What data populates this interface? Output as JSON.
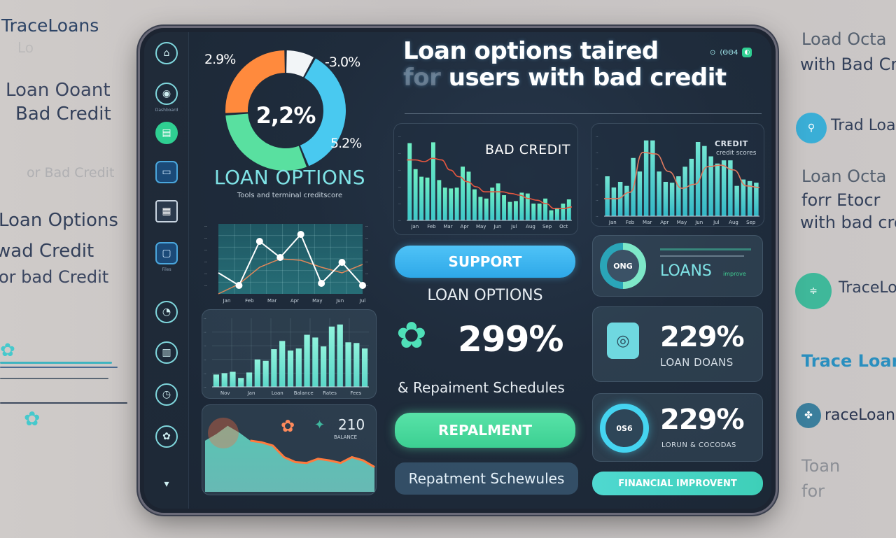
{
  "background": {
    "left": {
      "brand": "TraceLoans",
      "brand_faint": "Lo",
      "heading_line1": "Loan Ooant",
      "heading_line2": "Bad Credit",
      "faint_line": "or Bad Credit",
      "list_line1": "Loan Options",
      "list_line2": "wad Credit",
      "list_line3": "or bad Credit"
    },
    "right": {
      "line1": "Load Octa",
      "line2": "with Bad Credit",
      "item1_label": "Trad Loans",
      "line3": "Loan Octa",
      "line4": "forr Etocr",
      "line5": "with bad credit",
      "item2_label": "TraceLoans",
      "brand_link": "Trace Loans",
      "item3_label": "raceLoans",
      "line6": "Toan",
      "line7": "for"
    }
  },
  "app": {
    "title_line1": "Loan options taired",
    "title_prefix_ghost": "for",
    "title_line2": "users with bad credit",
    "status_icons": [
      "lock-icon",
      "battery-icon",
      "app-badge-icon"
    ],
    "status_text": "(ΘΘ4"
  },
  "sidebar": {
    "items": [
      {
        "icon": "home-icon",
        "glyph": "⌂"
      },
      {
        "icon": "eye-icon",
        "glyph": "◉",
        "label": "Dashboard"
      },
      {
        "icon": "document-icon",
        "glyph": "▤",
        "active": true
      },
      {
        "icon": "wallet-icon",
        "glyph": "▭"
      },
      {
        "icon": "calendar-icon",
        "glyph": "▦"
      },
      {
        "icon": "folder-icon",
        "glyph": "▢",
        "label": "Files"
      },
      {
        "icon": "gauge-icon",
        "glyph": "◔"
      },
      {
        "icon": "chart-icon",
        "glyph": "▥"
      },
      {
        "icon": "clock-icon",
        "glyph": "◷"
      },
      {
        "icon": "settings-icon",
        "glyph": "✿"
      },
      {
        "icon": "collapse-icon",
        "glyph": "▾"
      }
    ]
  },
  "donut": {
    "center_value": "2,2%",
    "label_top_left": "2.9%",
    "label_top_right": "-3.0%",
    "label_bottom_right": "5.2%",
    "title": "LOAN OPTIONS",
    "subtitle": "Tools and terminal creditscore",
    "colors": {
      "orange": "#ff8a3d",
      "white": "#f2f5f7",
      "cyan": "#49c9f0",
      "green": "#59e0a0"
    },
    "segments": [
      {
        "name": "white",
        "fraction": 0.08
      },
      {
        "name": "cyan",
        "fraction": 0.36
      },
      {
        "name": "green",
        "fraction": 0.3
      },
      {
        "name": "orange",
        "fraction": 0.26
      }
    ]
  },
  "chart_data": [
    {
      "id": "bad-credit-chart",
      "type": "bar",
      "title": "BAD CREDIT",
      "x_tick_labels": [
        "Jan",
        "Feb",
        "Mar",
        "Apr",
        "May",
        "Jun",
        "Jul",
        "Aug",
        "Sep",
        "Oct"
      ],
      "values": [
        92,
        61,
        52,
        51,
        93,
        48,
        39,
        38,
        39,
        64,
        58,
        37,
        28,
        26,
        39,
        44,
        30,
        22,
        23,
        33,
        32,
        20,
        20,
        26,
        12,
        15,
        20,
        25
      ],
      "trend": [
        72,
        72,
        70,
        74,
        72,
        60,
        52,
        46,
        40,
        34,
        34,
        34,
        32,
        30,
        26,
        24,
        20,
        14,
        14,
        16
      ],
      "ylim": [
        0,
        100
      ]
    },
    {
      "id": "credit-chart",
      "type": "bar",
      "title": "CREDIT",
      "subtitle": "credit scores",
      "x_tick_labels": [
        "Jan",
        "Feb",
        "Mar",
        "Apr",
        "May",
        "Jun",
        "Jul",
        "Aug",
        "Sep"
      ],
      "values": [
        50,
        36,
        43,
        38,
        73,
        56,
        95,
        95,
        56,
        43,
        42,
        50,
        62,
        72,
        93,
        88,
        75,
        66,
        70,
        70,
        38,
        46,
        44,
        42
      ],
      "trend": [
        22,
        22,
        30,
        80,
        78,
        56,
        35,
        40,
        62,
        64,
        58,
        38,
        36
      ],
      "ylim": [
        0,
        100
      ]
    },
    {
      "id": "line-chart",
      "type": "line",
      "x_tick_labels": [
        "Jan",
        "Feb",
        "Mar",
        "Apr",
        "May",
        "Jun",
        "Jul"
      ],
      "series": [
        {
          "name": "primary",
          "values": [
            30,
            12,
            75,
            52,
            85,
            15,
            45,
            12
          ]
        },
        {
          "name": "secondary",
          "values": [
            0,
            14,
            38,
            50,
            48,
            38,
            30,
            42
          ]
        }
      ],
      "ylim": [
        0,
        100
      ]
    },
    {
      "id": "monthly-bars",
      "type": "bar",
      "x_tick_labels": [
        "Nov",
        "Jan",
        "Loan",
        "Balance",
        "Rates",
        "Fees"
      ],
      "values": [
        18,
        20,
        22,
        13,
        21,
        40,
        38,
        55,
        67,
        53,
        56,
        76,
        72,
        59,
        88,
        91,
        65,
        64,
        56
      ],
      "ylim": [
        0,
        100
      ]
    },
    {
      "id": "area-chart",
      "type": "area",
      "annotation_value": "210",
      "annotation_label": "BALANCE",
      "values": [
        62,
        70,
        80,
        72,
        62,
        60,
        56,
        42,
        36,
        35,
        40,
        38,
        35,
        42,
        38,
        30
      ],
      "ylim": [
        0,
        100
      ]
    }
  ],
  "center": {
    "support_button": "SUPPORT",
    "loan_options_label": "LOAN OPTIONS",
    "big_value": "299%",
    "repayment_label": "& Repaiment Schedules",
    "repayment_button": "REPALMENT",
    "schedules_button": "Repatment Schewules"
  },
  "right_cards": [
    {
      "ring_text": "ONG",
      "line1": "──────",
      "title": "LOANS",
      "tag": "improve"
    },
    {
      "value": "229%",
      "label": "LOAN DOANS",
      "icon": "briefcase-icon"
    },
    {
      "ring_text": "0S6",
      "value": "229%",
      "label": "LORUN & COCODAS"
    }
  ],
  "financial_button": "FINANCIAL IMPROVENT"
}
